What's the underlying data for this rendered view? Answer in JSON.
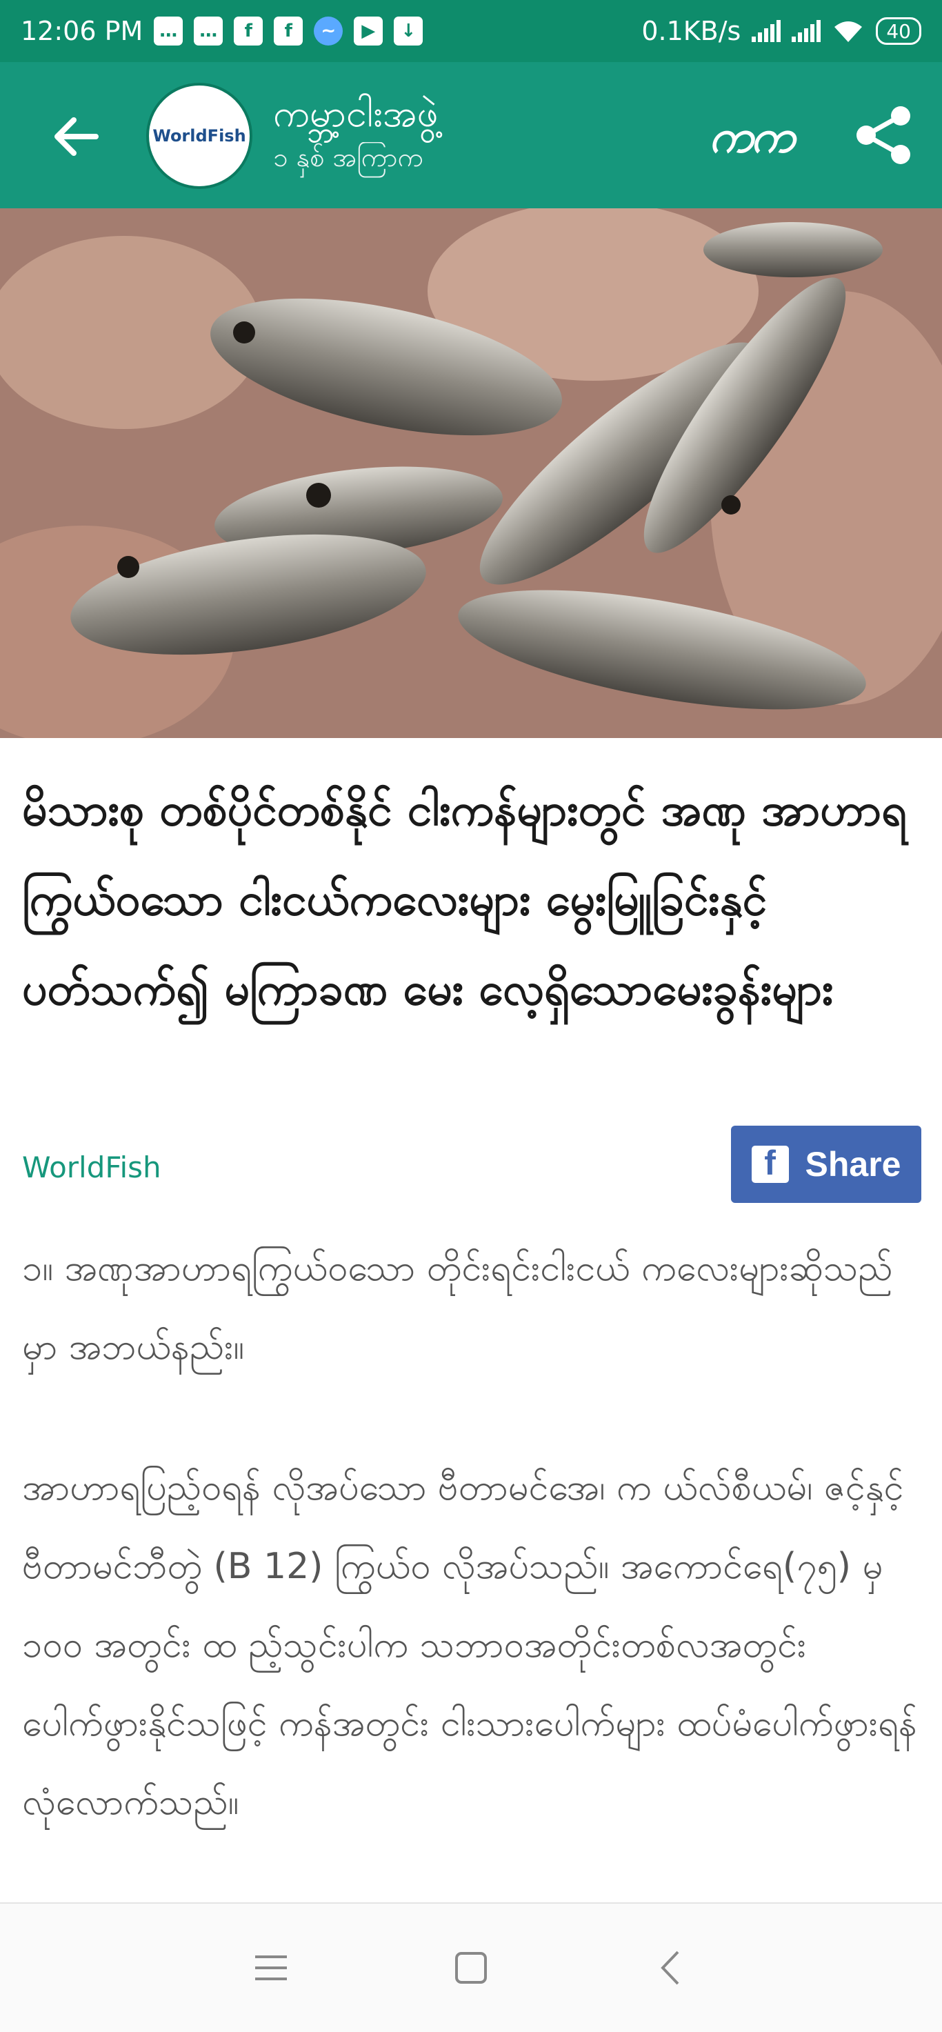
{
  "status_bar": {
    "time": "12:06 PM",
    "notification_icons": [
      "chat-icon",
      "chat-icon",
      "facebook-icon",
      "facebook-icon",
      "messenger-icon",
      "play-store-icon",
      "download-icon"
    ],
    "network_speed": "0.1KB/s",
    "battery": "40"
  },
  "app_bar": {
    "title": "ကမ္ဘာ့ငါးအဖွဲ့",
    "subtitle": "၁ နှစ် အကြာက",
    "avatar_label": "WorldFish",
    "font_toggle_label": "ကက"
  },
  "article": {
    "title": "မိသားစု တစ်ပိုင်တစ်နိုင် ငါးကန်များတွင် အဏု အာဟာရကြွယ်ဝသော ငါးငယ်ကလေးများ မွေးမြူခြင်းနှင့် ပတ်သက်၍ မကြာခဏ မေး လေ့ရှိသောမေးခွန်းများ",
    "source": "WorldFish",
    "share_label": "Share",
    "paragraph1": " ၁။ အဏုအာဟာရကြွယ်ဝသော တိုင်းရင်းငါးငယ် ကလေးများဆိုသည်မှာ အဘယ်နည်း။",
    "paragraph2": "အာဟာရပြည့်ဝရန် လိုအပ်သော ဗီတာမင်အေ၊ က ယ်လ်စီယမ်၊ ဇင့်နှင့် ဗီတာမင်ဘီတွဲ (B 12) ကြွယ်ဝ လိုအပ်သည်။ အကောင်ရေ(၇၅) မှ ၁၀၀ အတွင်း ထ ည့်သွင်းပါက သဘာဝအတိုင်းတစ်လအတွင်း ပေါက်ဖွားနိုင်သဖြင့် ကန်အတွင်း ငါးသားပေါက်များ ထပ်မံပေါက်ဖွားရန် လုံလောက်သည်။"
  },
  "colors": {
    "status_bar": "#0e8c6b",
    "app_bar": "#16977c",
    "facebook": "#4267b2",
    "source_link": "#16977c"
  }
}
